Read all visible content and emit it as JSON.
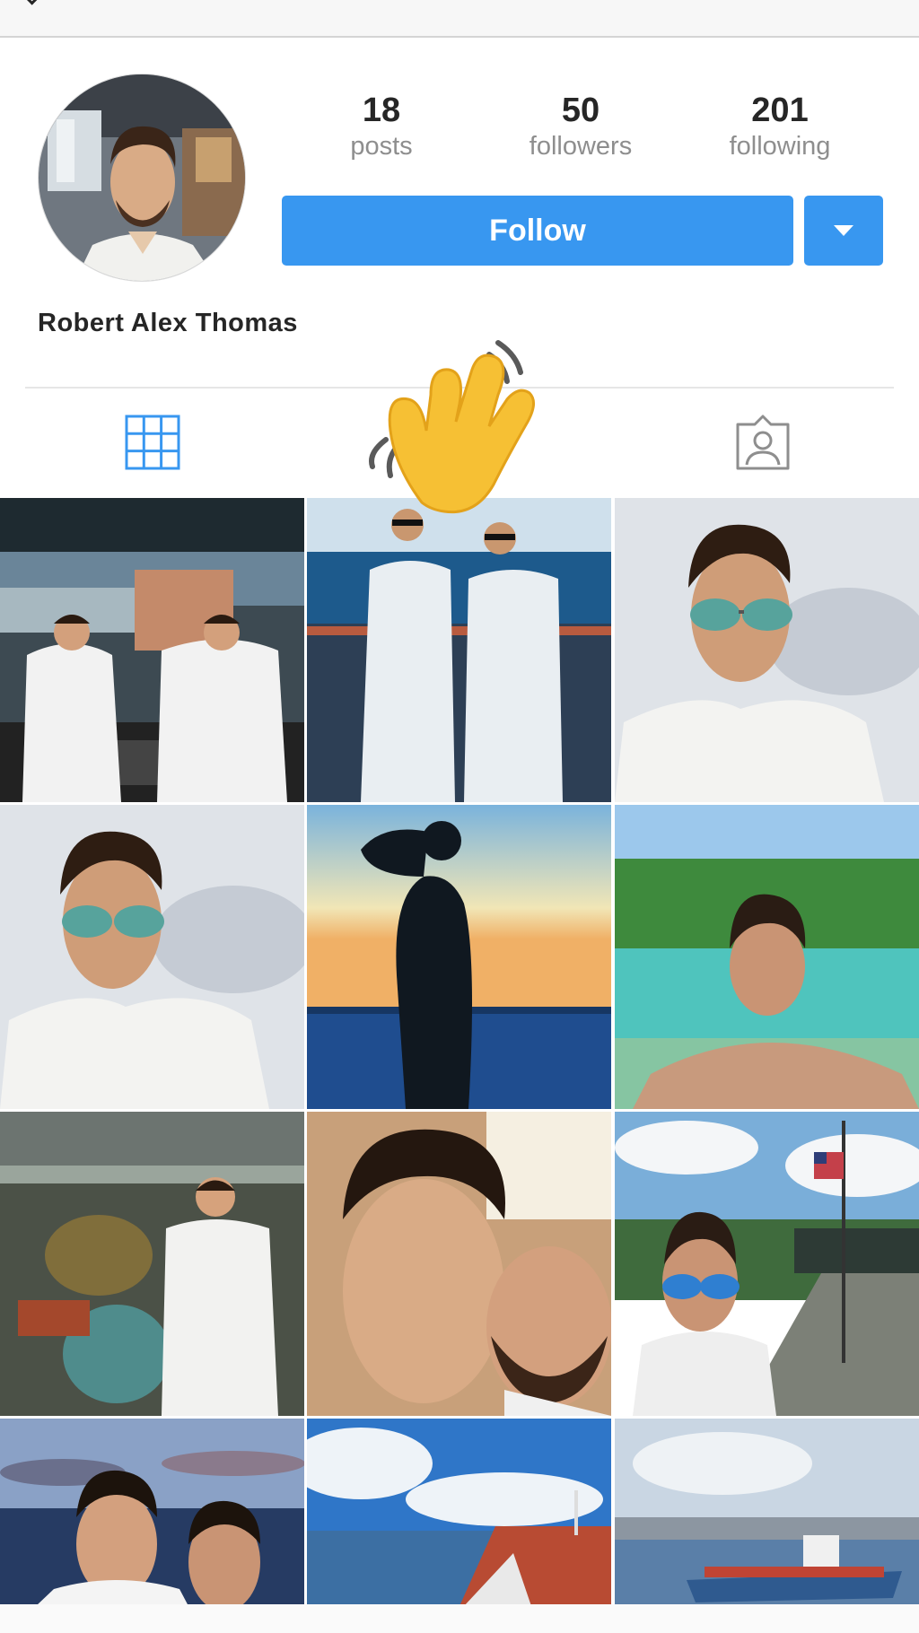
{
  "profile": {
    "name": "Robert Alex Thomas",
    "stats": [
      {
        "value": "18",
        "label": "posts"
      },
      {
        "value": "50",
        "label": "followers"
      },
      {
        "value": "201",
        "label": "following"
      }
    ],
    "follow_label": "Follow"
  },
  "tabs": [
    {
      "name": "grid",
      "icon": "grid-icon",
      "active": true
    },
    {
      "name": "tagged",
      "icon": "tagged-person-icon",
      "active": false
    }
  ],
  "overlay": {
    "emoji": "waving-hand"
  },
  "colors": {
    "accent": "#3897f0",
    "text": "#262626",
    "muted": "#8e8e8e",
    "divider": "#e6e6e6"
  },
  "photos": [
    {
      "subject": "two officers on ship bridge"
    },
    {
      "subject": "two officers at ship railing"
    },
    {
      "subject": "selfie with aviator sunglasses"
    },
    {
      "subject": "selfie with aviator sunglasses"
    },
    {
      "subject": "silhouette saluting at sunset"
    },
    {
      "subject": "man swimming in turquoise water"
    },
    {
      "subject": "officer in engine room"
    },
    {
      "subject": "two men smiling selfie"
    },
    {
      "subject": "selfie on pier with flag"
    },
    {
      "subject": "two officers at sea"
    },
    {
      "subject": "tanker ship deck"
    },
    {
      "subject": "container port"
    }
  ]
}
